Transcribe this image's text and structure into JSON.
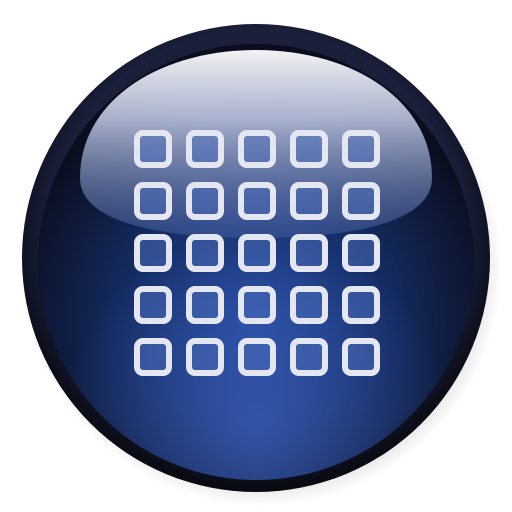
{
  "icon": {
    "name": "grid-app-icon",
    "shape": "glossy-circular-button",
    "rows": 5,
    "columns": 5,
    "colors": {
      "background": "#ffffff",
      "rim_outer": "#07080f",
      "rim_inner": "#1a1f3a",
      "body_center": "#23489a",
      "body_mid": "#16306c",
      "body_edge": "#0a0d1e",
      "highlight_top": "#ffffff",
      "highlight_bottom": "#5a73b8",
      "tile_stroke": "#e4e6f1",
      "tile_fill": "#4a6bb8"
    }
  }
}
